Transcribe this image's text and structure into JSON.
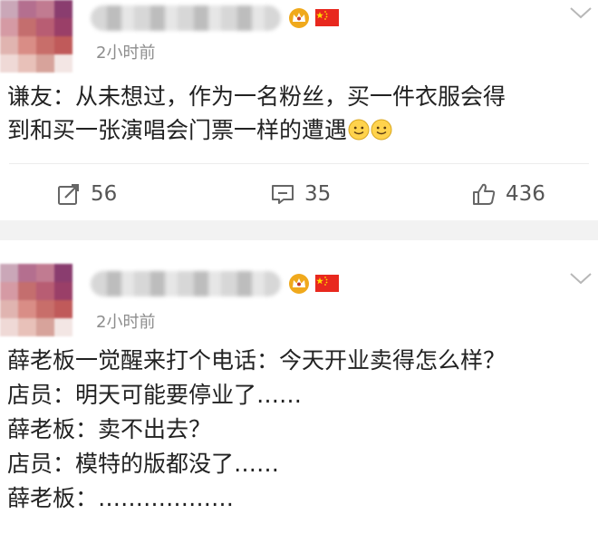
{
  "colors": {
    "flag_red": "#e8281e",
    "flag_yellow": "#ffde00",
    "crown_gold": "#f0a91c",
    "emoji_yellow": "#ffd34d"
  },
  "icons": [
    "repost-icon",
    "comment-icon",
    "like-icon",
    "crown-icon",
    "flag-icon",
    "chevron-down-icon",
    "smile-emoji-icon"
  ],
  "posts": [
    {
      "time": "2小时前",
      "lines": [
        "谦友：从未想过，作为一名粉丝，买一件衣服会得",
        "到和买一张演唱会门票一样的遭遇"
      ],
      "emoji_count": 2,
      "actions": {
        "repost": "56",
        "comment": "35",
        "like": "436"
      }
    },
    {
      "time": "2小时前",
      "lines": [
        "薛老板一觉醒来打个电话：今天开业卖得怎么样？",
        "店员：明天可能要停业了……",
        "薛老板：卖不出去？",
        "店员：模特的版都没了……",
        "薛老板：………………"
      ]
    }
  ]
}
